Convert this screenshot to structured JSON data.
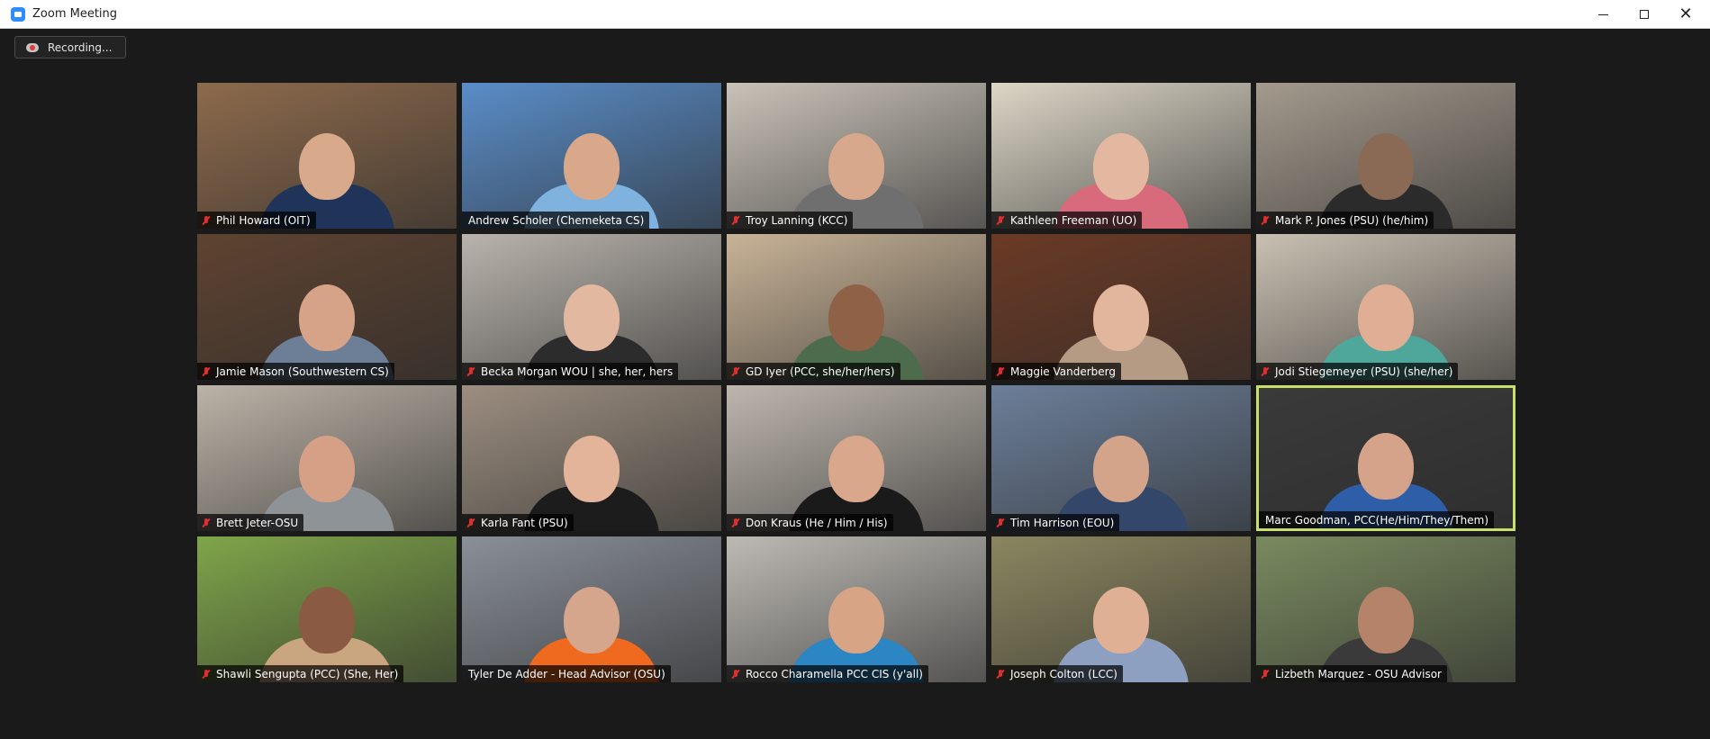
{
  "window": {
    "title": "Zoom Meeting",
    "app_icon": "zoom-camera-icon"
  },
  "window_controls": {
    "minimize": "minimize-icon",
    "maximize": "maximize-icon",
    "close": "close-icon"
  },
  "recording": {
    "label": "Recording...",
    "icon": "record-icon"
  },
  "participants": [
    {
      "name": "Phil Howard (OIT)",
      "muted": true,
      "bg": "#8d6a4c",
      "skin": "#d8a98a",
      "shirt": "#1f3458"
    },
    {
      "name": "Andrew Scholer (Chemeketa CS)",
      "muted": false,
      "bg": "#5a8dc8",
      "skin": "#d9a78a",
      "shirt": "#7fb2df"
    },
    {
      "name": "Troy Lanning (KCC)",
      "muted": true,
      "bg": "#c9c2b8",
      "skin": "#d8a88c",
      "shirt": "#6f6f6f"
    },
    {
      "name": "Kathleen Freeman (UO)",
      "muted": true,
      "bg": "#dcd6c6",
      "skin": "#e4b8a0",
      "shirt": "#d76b7c"
    },
    {
      "name": "Mark P. Jones (PSU) (he/him)",
      "muted": true,
      "bg": "#a49a8d",
      "skin": "#8b6a55",
      "shirt": "#2b2b2b"
    },
    {
      "name": "Jamie Mason (Southwestern CS)",
      "muted": true,
      "bg": "#5e4331",
      "skin": "#d6a288",
      "shirt": "#6c7f97"
    },
    {
      "name": "Becka Morgan WOU | she, her, hers",
      "muted": true,
      "bg": "#b9b3ac",
      "skin": "#e3b8a1",
      "shirt": "#2c2c2c"
    },
    {
      "name": "GD Iyer (PCC, she/her/hers)",
      "muted": true,
      "bg": "#c8b397",
      "skin": "#8f6248",
      "shirt": "#4d6b4d"
    },
    {
      "name": "Maggie Vanderberg",
      "muted": true,
      "bg": "#6b3a25",
      "skin": "#e2b69d",
      "shirt": "#b59b84"
    },
    {
      "name": "Jodi Stiegemeyer (PSU) (she/her)",
      "muted": true,
      "bg": "#c9c0b1",
      "skin": "#dfae94",
      "shirt": "#4fa79b"
    },
    {
      "name": "Brett Jeter-OSU",
      "muted": true,
      "bg": "#bcb3a7",
      "skin": "#d5a085",
      "shirt": "#8e9398"
    },
    {
      "name": "Karla Fant (PSU)",
      "muted": true,
      "bg": "#9c8e80",
      "skin": "#e3b49a",
      "shirt": "#1c1c1c"
    },
    {
      "name": "Don Kraus (He / Him / His)",
      "muted": true,
      "bg": "#bdb6ad",
      "skin": "#d9a88c",
      "shirt": "#1a1a1a"
    },
    {
      "name": "Tim Harrison (EOU)",
      "muted": true,
      "bg": "#6c7f99",
      "skin": "#d3a48a",
      "shirt": "#33476a"
    },
    {
      "name": "Marc Goodman, PCC(He/Him/They/Them)",
      "muted": false,
      "bg": "#3a3a3a",
      "skin": "#d4a38a",
      "shirt": "#2f5ea8"
    },
    {
      "name": "Shawli Sengupta (PCC) (She, Her)",
      "muted": true,
      "bg": "#7fa54a",
      "skin": "#8a5b42",
      "shirt": "#c9a680"
    },
    {
      "name": "Tyler De Adder - Head Advisor (OSU)",
      "muted": false,
      "bg": "#8a8f98",
      "skin": "#d5a68c",
      "shirt": "#ef6a1e"
    },
    {
      "name": "Rocco Charamella PCC CIS (y'all)",
      "muted": true,
      "bg": "#bdbab4",
      "skin": "#d7a486",
      "shirt": "#2c86c4"
    },
    {
      "name": "Joseph Colton (LCC)",
      "muted": true,
      "bg": "#8b8660",
      "skin": "#e0b095",
      "shirt": "#8ea0c2"
    },
    {
      "name": "Lizbeth Marquez - OSU Advisor",
      "muted": true,
      "bg": "#7a8a5f",
      "skin": "#b5826a",
      "shirt": "#3a3a3a"
    }
  ],
  "active_speaker_index": 14
}
